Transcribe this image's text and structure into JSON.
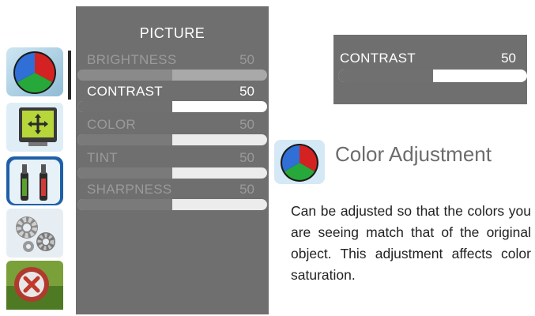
{
  "menu": {
    "title": "PICTURE",
    "items": [
      {
        "label": "BRIGHTNESS",
        "value": "50",
        "level": 0.5,
        "state": "dim-first"
      },
      {
        "label": "CONTRAST",
        "value": "50",
        "level": 0.5,
        "state": "selected"
      },
      {
        "label": "COLOR",
        "value": "50",
        "level": 0.5,
        "state": "dim"
      },
      {
        "label": "TINT",
        "value": "50",
        "level": 0.5,
        "state": "dim"
      },
      {
        "label": "SHARPNESS",
        "value": "50",
        "level": 0.5,
        "state": "dim"
      }
    ]
  },
  "side_icons": [
    "color-palette-icon",
    "screen-position-icon",
    "audio-icon",
    "setup-gears-icon",
    "lock-icon"
  ],
  "preview": {
    "label": "CONTRAST",
    "value": "50",
    "level": 0.5
  },
  "section": {
    "title": "Color Adjustment",
    "description": "Can be adjusted so that the colors you are seeing match that of the original object. This adjustment affects color saturation."
  },
  "colors": {
    "panel": "#6f6f6f",
    "text_on_panel": "#ffffff",
    "dim_text": "#9a9a9a",
    "heading": "#6c6c6c"
  }
}
